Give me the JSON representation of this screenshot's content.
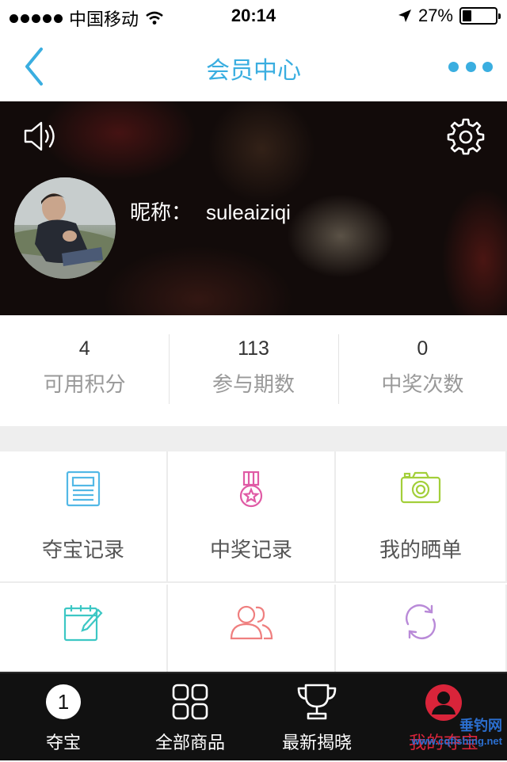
{
  "status_bar": {
    "carrier": "中国移动",
    "time": "20:14",
    "battery": "27%",
    "battery_level": 0.27
  },
  "nav": {
    "title": "会员中心"
  },
  "profile": {
    "nickname_label": "昵称：",
    "nickname": "suleaiziqi"
  },
  "stats": [
    {
      "value": "4",
      "label": "可用积分"
    },
    {
      "value": "113",
      "label": "参与期数"
    },
    {
      "value": "0",
      "label": "中奖次数"
    }
  ],
  "menu": [
    {
      "label": "夺宝记录",
      "icon": "news-icon",
      "color": "#52b8e6"
    },
    {
      "label": "中奖记录",
      "icon": "medal-icon",
      "color": "#e05aa5"
    },
    {
      "label": "我的晒单",
      "icon": "camera-icon",
      "color": "#a3cf3a"
    },
    {
      "label": "",
      "icon": "edit-calendar-icon",
      "color": "#3cc7c4"
    },
    {
      "label": "",
      "icon": "friends-icon",
      "color": "#ef7f7f"
    },
    {
      "label": "",
      "icon": "refresh-icon",
      "color": "#b98ad8"
    }
  ],
  "tabs": [
    {
      "label": "夺宝",
      "icon": "number-one-icon"
    },
    {
      "label": "全部商品",
      "icon": "grid-icon"
    },
    {
      "label": "最新揭晓",
      "icon": "trophy-icon"
    },
    {
      "label": "我的夺宝",
      "icon": "user-icon",
      "active": true
    }
  ],
  "watermark": {
    "text": "垂钓网",
    "url": "www.cqfishing.net"
  }
}
